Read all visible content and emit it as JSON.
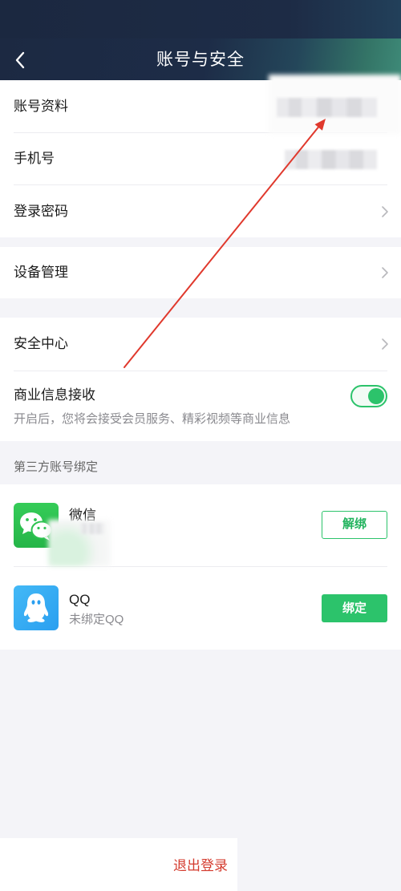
{
  "header": {
    "title": "账号与安全",
    "back_icon": "chevron-left-icon"
  },
  "settings": {
    "account_profile": {
      "label": "账号资料"
    },
    "phone": {
      "label": "手机号"
    },
    "login_password": {
      "label": "登录密码",
      "icon": "chevron-right-icon"
    },
    "device_management": {
      "label": "设备管理",
      "icon": "chevron-right-icon"
    },
    "security_center": {
      "label": "安全中心",
      "icon": "chevron-right-icon"
    },
    "commercial_info": {
      "label": "商业信息接收",
      "description": "开启后，您将会接受会员服务、精彩视频等商业信息",
      "enabled": true
    }
  },
  "third_party": {
    "section_title": "第三方账号绑定",
    "accounts": [
      {
        "name": "微信",
        "icon": "wechat-icon",
        "button": "解绑",
        "bound": true
      },
      {
        "name": "QQ",
        "icon": "qq-icon",
        "status": "未绑定QQ",
        "button": "绑定",
        "bound": false
      }
    ]
  },
  "footer": {
    "logout_label": "退出登录"
  },
  "colors": {
    "header_dark": "#1c2942",
    "header_teal": "#3e8a78",
    "accent_green": "#2cc36b",
    "logout_red": "#d43b2e",
    "annotation_red": "#e0392d",
    "page_bg": "#f4f4f8"
  }
}
